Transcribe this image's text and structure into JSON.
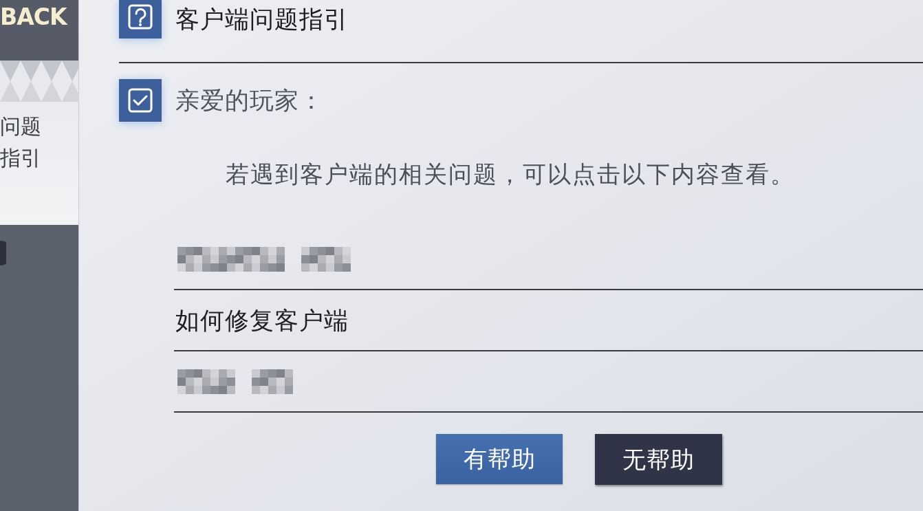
{
  "sidebar": {
    "back_label": "BACK",
    "items": [
      {
        "label": "问题指引",
        "selected": true
      }
    ]
  },
  "header": {
    "title": "客户端问题指引"
  },
  "notice": {
    "greeting": "亲爱的玩家：",
    "message": "若遇到客户端的相关问题，可以点击以下内容查看。"
  },
  "links": [
    {
      "kind": "redacted"
    },
    {
      "kind": "text",
      "label": "如何修复客户端"
    },
    {
      "kind": "redacted"
    }
  ],
  "buttons": [
    {
      "label": "有帮助",
      "kind": "primary"
    },
    {
      "label": "无帮助",
      "kind": "secondary"
    }
  ]
}
